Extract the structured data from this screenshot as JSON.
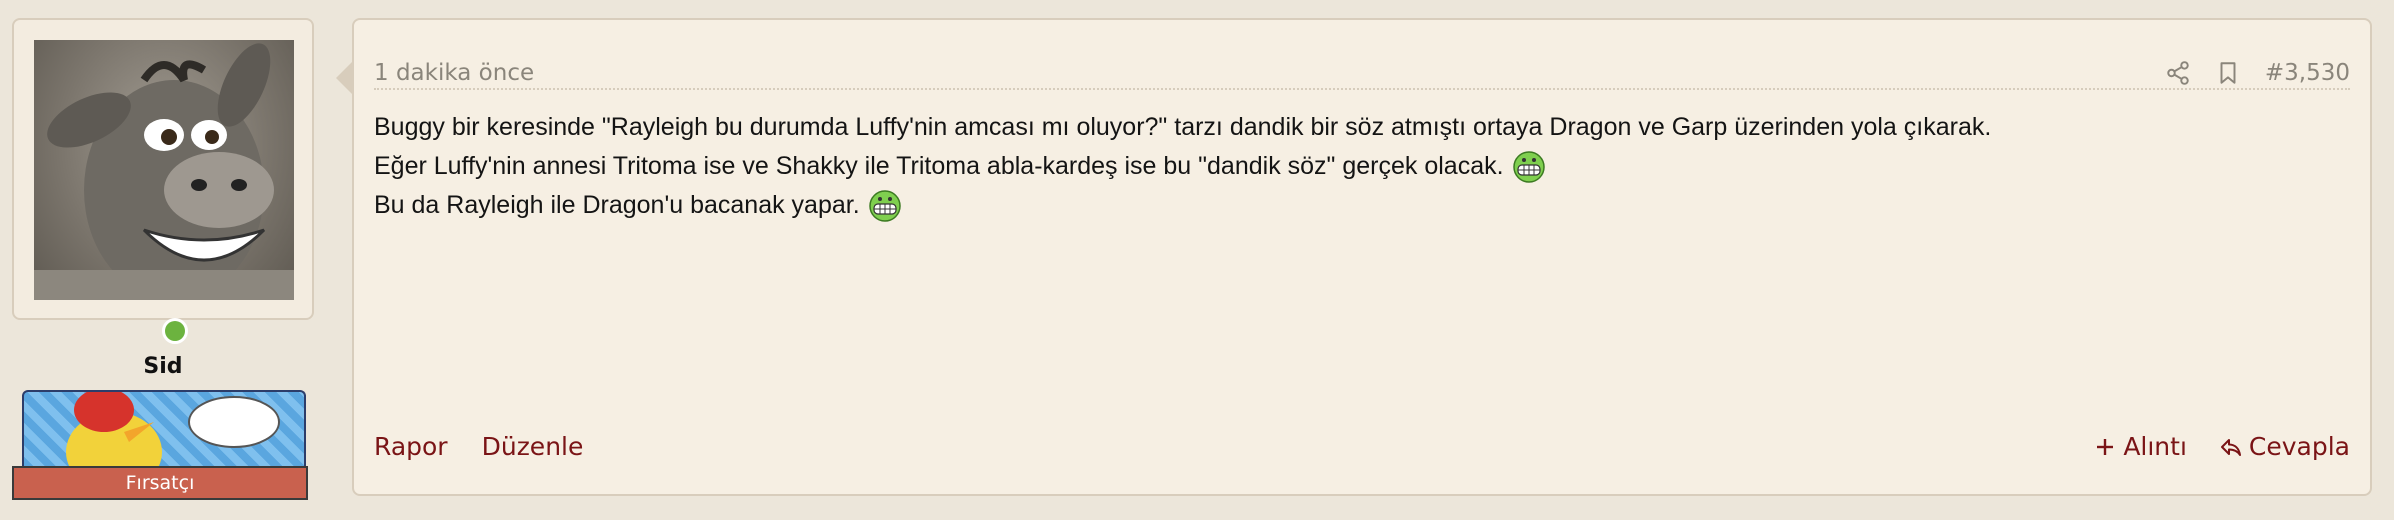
{
  "user": {
    "name": "Sid",
    "online_color": "#6cb33f",
    "banner_label": "Fırsatçı",
    "banner_color": "#c9614e"
  },
  "post": {
    "time": "1 dakika önce",
    "number": "#3,530",
    "header_icons": [
      "share-icon",
      "bookmark-icon"
    ],
    "lines": [
      "Buggy bir keresinde \"Rayleigh bu durumda Luffy'nin amcası mı oluyor?\" tarzı dandik bir söz atmıştı ortaya Dragon ve Garp üzerinden yola çıkarak.",
      "Eğer Luffy'nin annesi Tritoma ise ve Shakky ile Tritoma abla-kardeş ise bu \"dandik söz\" gerçek olacak.",
      "Bu da Rayleigh ile Dragon'u bacanak yapar."
    ],
    "emoji": "grin-emoji"
  },
  "actions": {
    "report": "Rapor",
    "edit": "Düzenle",
    "quote": "Alıntı",
    "reply": "Cevapla",
    "link_color": "#7a1416"
  }
}
